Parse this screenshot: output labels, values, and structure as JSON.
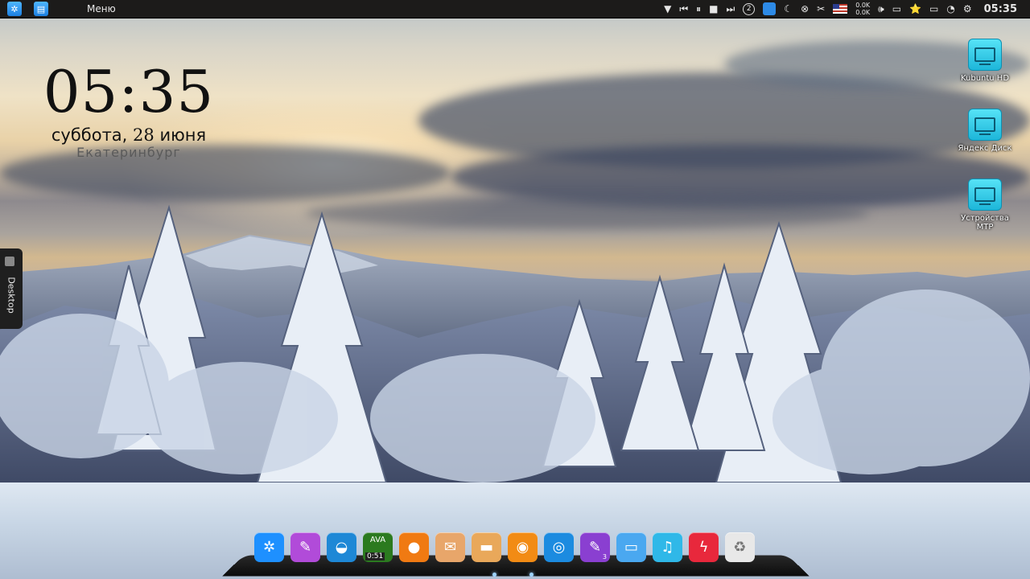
{
  "top_panel": {
    "menu_label": "Меню",
    "tray": {
      "workspace_number": "2",
      "net_up": "0.0K",
      "net_down": "0.0K",
      "time": "05:35"
    }
  },
  "clock_widget": {
    "time": "05:35",
    "weekday": "суббота",
    "day": "28",
    "month": "июня",
    "city": "Екатеринбург"
  },
  "side_tab": {
    "label": "Desktop"
  },
  "desktop_icons": [
    {
      "label": "Kubuntu HD"
    },
    {
      "label": "Яндекс Диск"
    },
    {
      "label": "Устройства MTP"
    }
  ],
  "dock": {
    "clock_app_time": "0:51",
    "clock_app_header": "AVA",
    "editor_badge": "3",
    "colors": {
      "settings": "#1e90ff",
      "paint": "#b14bd9",
      "browser": "#1e88d6",
      "clock": "#2b7a1f",
      "pac": "#f07a12",
      "mail": "#e8a66a",
      "files": "#e9a85a",
      "firefox": "#f28b14",
      "chrome": "#1c8be0",
      "editor": "#8a3fd1",
      "folder": "#4aa8f0",
      "music": "#2fb8e8",
      "flash": "#e8283c",
      "trash": "#e8e8e8"
    }
  }
}
